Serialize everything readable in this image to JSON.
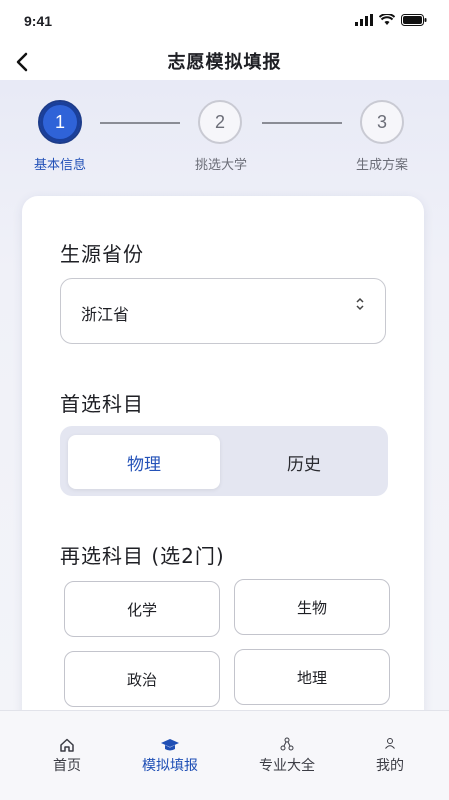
{
  "status_bar": {
    "time": "9:41"
  },
  "nav": {
    "title": "志愿模拟填报",
    "back_icon": "chevron-left-icon"
  },
  "stepper": {
    "steps": [
      {
        "number": "1",
        "label": "基本信息",
        "state": "active"
      },
      {
        "number": "2",
        "label": "挑选大学",
        "state": "inactive"
      },
      {
        "number": "3",
        "label": "生成方案",
        "state": "inactive"
      }
    ]
  },
  "form": {
    "province": {
      "label": "生源省份",
      "value": "浙江省"
    },
    "primary_subject": {
      "label": "首选科目",
      "options": [
        "物理",
        "历史"
      ],
      "selected": "物理"
    },
    "secondary_subjects": {
      "label": "再选科目 (选2门)",
      "options": [
        "化学",
        "生物",
        "政治",
        "地理"
      ]
    }
  },
  "tabbar": {
    "items": [
      {
        "label": "首页",
        "icon": "home-icon",
        "active": false
      },
      {
        "label": "模拟填报",
        "icon": "graduation-cap-icon",
        "active": true
      },
      {
        "label": "专业大全",
        "icon": "network-icon",
        "active": false
      },
      {
        "label": "我的",
        "icon": "person-icon",
        "active": false
      }
    ]
  },
  "colors": {
    "accent": "#2f63d8",
    "accent_text": "#2452b8",
    "background": "#f1f2f8"
  }
}
